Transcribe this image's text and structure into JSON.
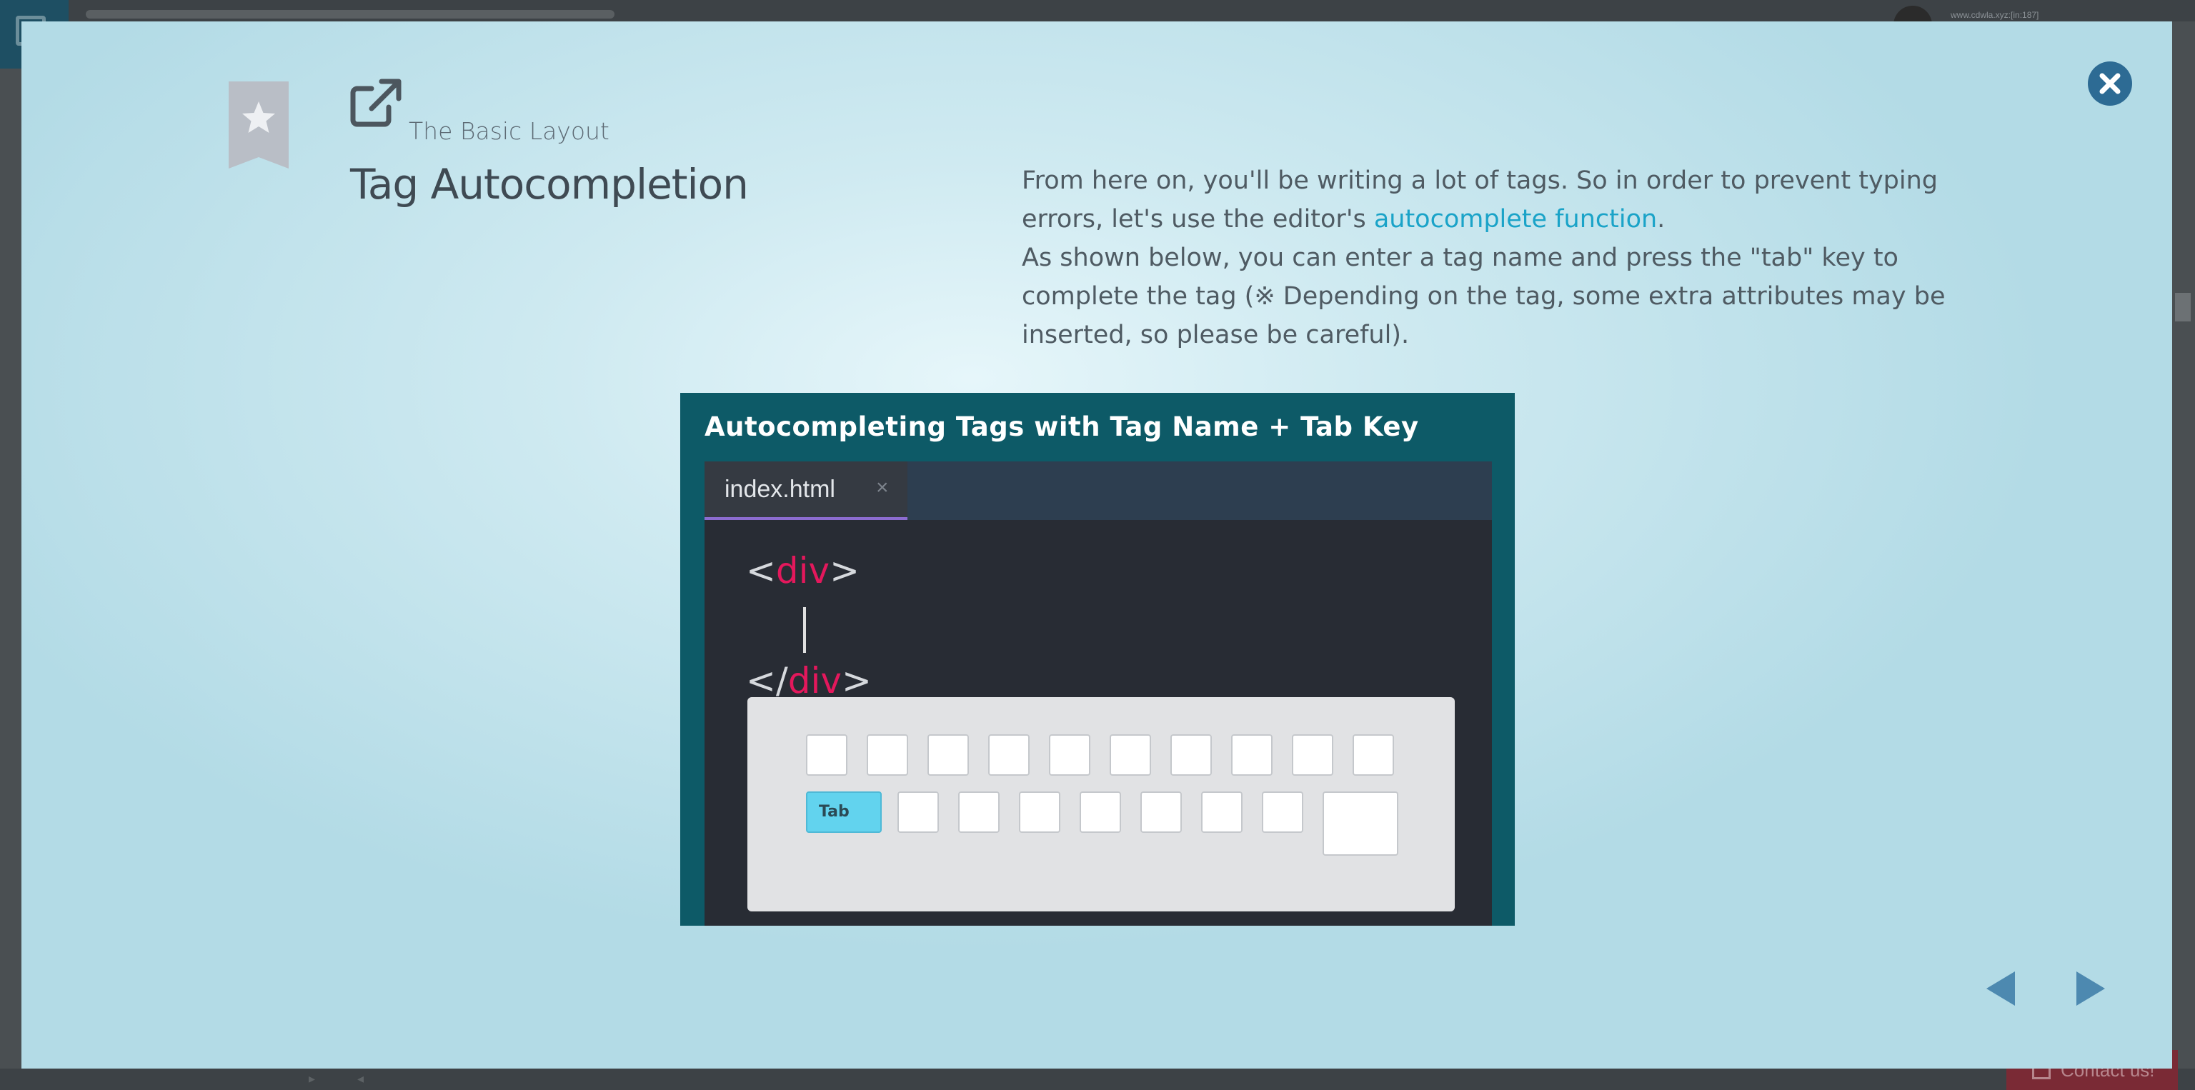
{
  "background": {
    "url_text": "www.cdwla.xyz:[in:187]",
    "contact_label": "Contact us!"
  },
  "modal": {
    "chapter_label": "The Basic Layout",
    "title": "Tag Autocompletion",
    "description": {
      "part1": "From here on, you'll be writing a lot of tags. So in order to prevent typing errors, let's use the editor's ",
      "link_text": "autocomplete function",
      "part2": ".",
      "part3": "As shown below, you can enter a tag name and press the \"tab\" key to complete the tag (※ Depending on the tag, some extra attributes may be inserted, so please be careful)."
    },
    "illustration": {
      "heading": "Autocompleting Tags with Tag Name + Tab Key",
      "tab_filename": "index.html",
      "tab_close": "×",
      "code_line1_open": "<",
      "code_line1_tag": "div",
      "code_line1_close": ">",
      "code_line3_open": "</",
      "code_line3_tag": "div",
      "code_line3_close": ">",
      "tab_key_label": "Tab"
    },
    "icons": {
      "close": "close-icon",
      "bookmark": "bookmark-star-icon",
      "external_link": "external-link-icon",
      "prev": "triangle-left-icon",
      "next": "triangle-right-icon"
    },
    "colors": {
      "link": "#1aa3c8",
      "close_button": "#2d6b94",
      "illustration_bg": "#0d5a67",
      "editor_bg": "#282c34",
      "tag_color": "#e3185c",
      "tab_key": "#62d3ee"
    }
  }
}
